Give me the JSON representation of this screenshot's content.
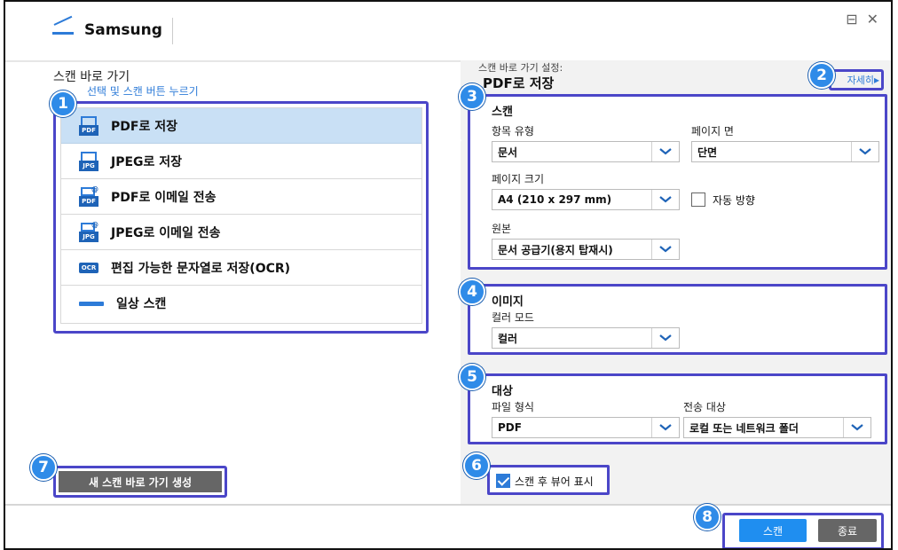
{
  "header": {
    "brand": "Samsung",
    "minimize": "⊟",
    "close": "✕"
  },
  "left": {
    "title": "스캔 바로 가기",
    "subtitle": "선택 및 스캔 버튼 누르기",
    "items": [
      {
        "label": "PDF로 저장",
        "icon": "scan-to-pdf-icon",
        "icon_text": "PDF",
        "selected": true
      },
      {
        "label": "JPEG로 저장",
        "icon": "scan-to-jpeg-icon",
        "icon_text": "JPG",
        "selected": false
      },
      {
        "label": "PDF로 이메일 전송",
        "icon": "email-pdf-icon",
        "icon_text": "PDF",
        "selected": false
      },
      {
        "label": "JPEG로 이메일 전송",
        "icon": "email-jpeg-icon",
        "icon_text": "JPG",
        "selected": false
      },
      {
        "label": "편집 가능한 문자열로 저장(OCR)",
        "icon": "ocr-icon",
        "icon_text": "OCR",
        "selected": false
      },
      {
        "label": "일상 스캔",
        "icon": "everyday-scan-icon",
        "icon_text": "",
        "selected": false
      }
    ],
    "new_shortcut_button": "새 스캔 바로 가기 생성"
  },
  "right": {
    "caption": "스캔 바로 가기 설정:",
    "title": "PDF로 저장",
    "details_link": "자세히",
    "scan": {
      "title": "스캔",
      "item_type_label": "항목 유형",
      "item_type_value": "문서",
      "page_side_label": "페이지 면",
      "page_side_value": "단면",
      "page_size_label": "페이지 크기",
      "page_size_value": "A4 (210 x 297 mm)",
      "auto_orient_label": "자동 방향",
      "auto_orient_checked": false,
      "source_label": "원본",
      "source_value": "문서 공급기(용지 탑재시)"
    },
    "image": {
      "title": "이미지",
      "color_mode_label": "컬러 모드",
      "color_mode_value": "컬러"
    },
    "destination": {
      "title": "대상",
      "file_format_label": "파일 형식",
      "file_format_value": "PDF",
      "send_to_label": "전송 대상",
      "send_to_value": "로컬 또는 네트워크 폴더"
    },
    "show_viewer_label": "스캔 후 뷰어 표시",
    "show_viewer_checked": true
  },
  "footer": {
    "scan_button": "스캔",
    "close_button": "종료"
  },
  "callouts": [
    "1",
    "2",
    "3",
    "4",
    "5",
    "6",
    "7",
    "8"
  ],
  "colors": {
    "accent": "#2d7bd8",
    "highlight_border": "#4b46c8",
    "selected_row": "#c9e0f5",
    "badge": "#2f8be8"
  }
}
